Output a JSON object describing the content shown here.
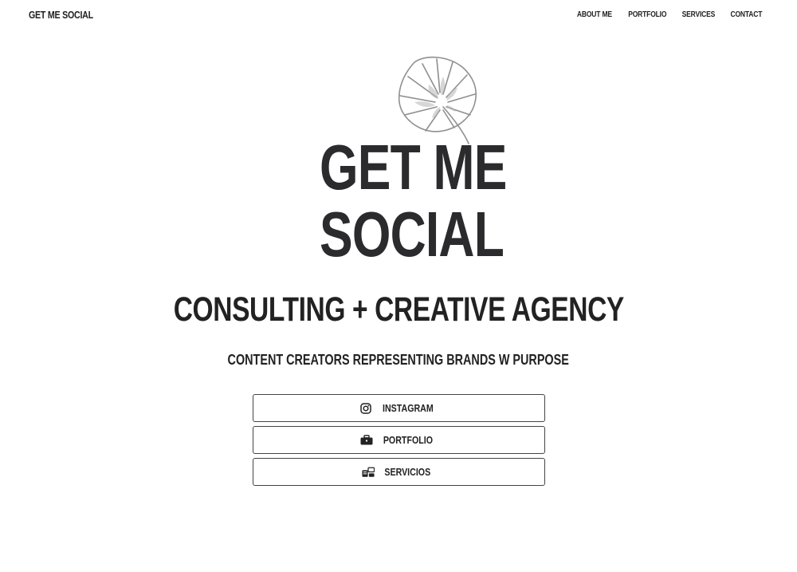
{
  "header": {
    "brand": "GET ME SOCIAL",
    "nav": [
      {
        "label": "ABOUT ME"
      },
      {
        "label": "PORTFOLIO"
      },
      {
        "label": "SERVICES"
      },
      {
        "label": "CONTACT"
      }
    ]
  },
  "hero": {
    "logo_line1": "GET ME",
    "logo_line2": "SOCIAL",
    "logo_icon": "monstera-leaf-icon",
    "headline": "CONSULTING + CREATIVE AGENCY",
    "tagline": "CONTENT CREATORS REPRESENTING BRANDS W PURPOSE"
  },
  "links": [
    {
      "label": "INSTAGRAM",
      "icon": "instagram-icon"
    },
    {
      "label": "PORTFOLIO",
      "icon": "briefcase-icon"
    },
    {
      "label": "SERVICIOS",
      "icon": "services-icon"
    }
  ],
  "colors": {
    "background": "#ffffff",
    "text": "#222222",
    "border": "#444444",
    "leaf": "#9a9a9a"
  }
}
